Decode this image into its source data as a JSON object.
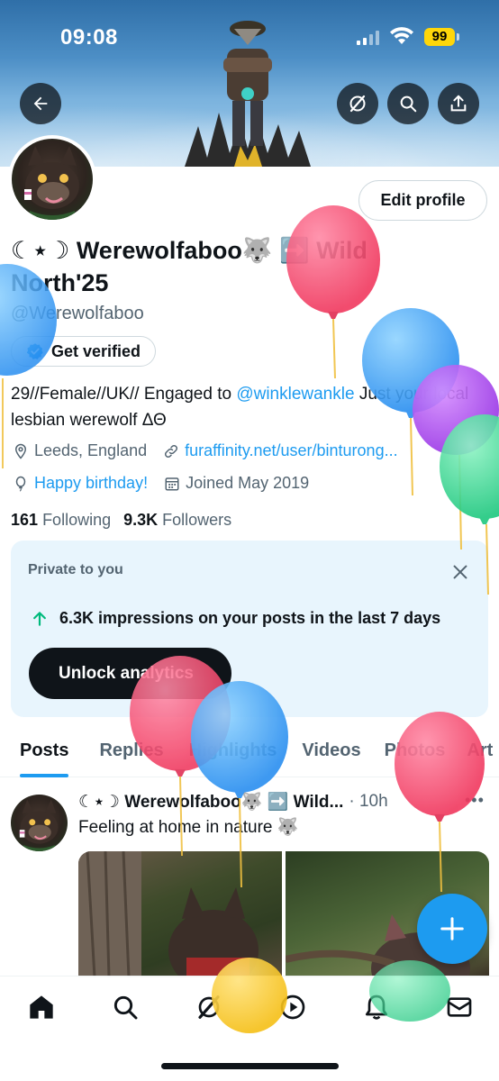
{
  "status_bar": {
    "time": "09:08",
    "battery": "99"
  },
  "profile": {
    "display_name": "☾⋆☽ Werewolfaboo🐺 ➡️ Wild North'25",
    "handle": "@Werewolfaboo",
    "edit_profile_label": "Edit profile",
    "get_verified_label": "Get verified",
    "bio_prefix": "29//Female//UK// Engaged to ",
    "bio_mention": "@winklewankle",
    "bio_suffix": " Just your local lesbian werewolf ΔΘ",
    "location": "Leeds, England",
    "website": "furaffinity.net/user/binturong...",
    "birthday": "Happy birthday!",
    "joined": "Joined May 2019",
    "following_count": "161",
    "following_label": "Following",
    "followers_count": "9.3K",
    "followers_label": "Followers"
  },
  "private_card": {
    "title": "Private to you",
    "impressions_text": "6.3K impressions on your posts in the last 7 days",
    "unlock_label": "Unlock analytics"
  },
  "tabs": [
    "Posts",
    "Replies",
    "Highlights",
    "Videos",
    "Photos",
    "Art"
  ],
  "post": {
    "author": "☾⋆☽ Werewolfaboo🐺 ➡️ Wild...",
    "time": "· 10h",
    "text": "Feeling at home in nature 🐺"
  },
  "colors": {
    "accent": "#1d9bf0",
    "text": "#0f1419",
    "muted": "#536471",
    "card_bg": "#e8f5fd",
    "battery": "#ffd60a"
  },
  "icons": {
    "back": "arrow-left-icon",
    "grok": "grok-icon",
    "search": "search-icon",
    "share": "share-icon",
    "location": "location-pin-icon",
    "link": "link-icon",
    "birthday": "balloon-icon",
    "calendar": "calendar-icon",
    "verified": "verified-badge-icon",
    "analytics_up": "arrow-up-icon",
    "close": "close-icon",
    "compose": "plus-icon",
    "nav": [
      "home-icon",
      "search-icon",
      "grok-icon",
      "video-icon",
      "bell-icon",
      "mail-icon"
    ]
  }
}
